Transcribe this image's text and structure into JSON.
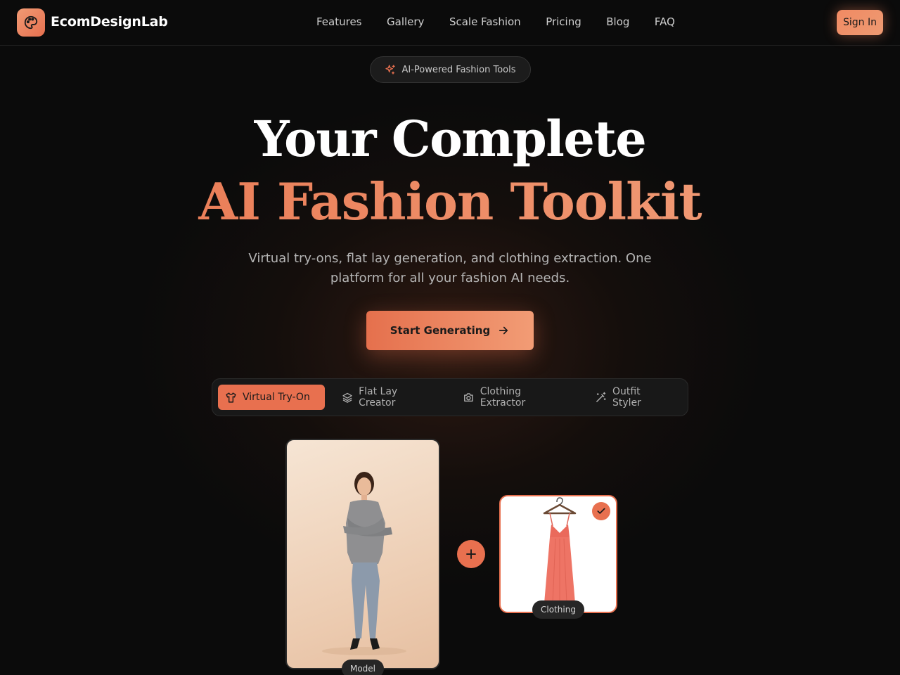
{
  "brand": {
    "name": "EcomDesignLab",
    "logo_icon": "palette-icon"
  },
  "nav": {
    "links": [
      "Features",
      "Gallery",
      "Scale Fashion",
      "Pricing",
      "Blog",
      "FAQ"
    ],
    "signin_label": "Sign In"
  },
  "hero": {
    "badge": "AI-Powered Fashion Tools",
    "title_line1": "Your Complete",
    "title_line2": "AI Fashion Toolkit",
    "subtitle": "Virtual try-ons, flat lay generation, and clothing extraction. One platform for all your fashion AI needs.",
    "cta_label": "Start Generating"
  },
  "tabs": [
    {
      "label": "Virtual Try-On",
      "icon": "shirt-icon",
      "active": true
    },
    {
      "label": "Flat Lay Creator",
      "icon": "layers-icon",
      "active": false
    },
    {
      "label": "Clothing Extractor",
      "icon": "camera-icon",
      "active": false
    },
    {
      "label": "Outfit Styler",
      "icon": "wand-icon",
      "active": false
    }
  ],
  "demo": {
    "model_label": "Model",
    "clothing_label": "Clothing"
  },
  "colors": {
    "accent": "#e8704f",
    "accent_light": "#f29c75",
    "background": "#0b0b0b"
  }
}
